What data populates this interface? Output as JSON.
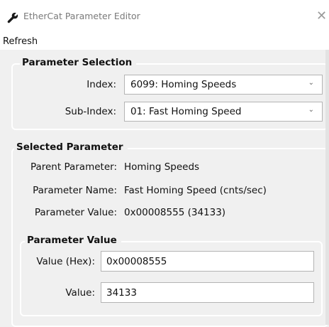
{
  "window": {
    "title": "EtherCat Parameter Editor",
    "title_icon": "wrench-icon",
    "close_icon": "close-icon"
  },
  "menu": {
    "refresh": "Refresh"
  },
  "selection": {
    "legend": "Parameter Selection",
    "index_label": "Index:",
    "index_value": "6099: Homing Speeds",
    "subindex_label": "Sub-Index:",
    "subindex_value": "01: Fast Homing Speed"
  },
  "selected": {
    "legend": "Selected Parameter",
    "parent_label": "Parent Parameter:",
    "parent_value": "Homing Speeds",
    "name_label": "Parameter Name:",
    "name_value": "Fast Homing Speed (cnts/sec)",
    "value_label": "Parameter Value:",
    "value_value": "0x00008555 (34133)"
  },
  "param_value": {
    "legend": "Parameter Value",
    "hex_label": "Value (Hex):",
    "hex_value": "0x00008555",
    "dec_label": "Value:",
    "dec_value": "34133"
  },
  "colors": {
    "background": "#f0f0f0",
    "group_border": "#ffffff",
    "title_text": "#7a7a7a"
  }
}
